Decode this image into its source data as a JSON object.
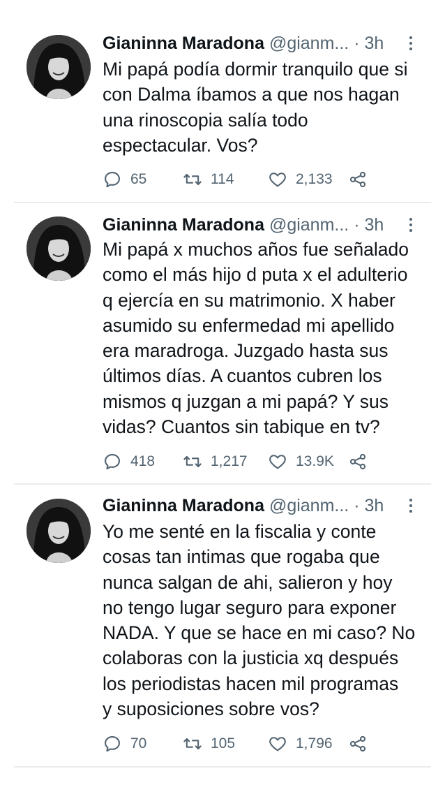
{
  "tweets": [
    {
      "author_name": "Gianinna Maradona",
      "handle": "@gianm...",
      "separator": "·",
      "time": "3h",
      "text": "Mi papá podía dormir tranquilo que si\ncon Dalma íbamos a que nos hagan\nuna rinoscopia salía todo\nespectacular. Vos?",
      "replies": "65",
      "retweets": "114",
      "likes": "2,133"
    },
    {
      "author_name": "Gianinna Maradona",
      "handle": "@gianm...",
      "separator": "·",
      "time": "3h",
      "text": "Mi papá x muchos años fue señalado\ncomo el más hijo d puta x el adulterio\nq ejercía en su matrimonio. X haber\nasumido su enfermedad mi apellido\nera maradroga. Juzgado hasta sus\núltimos días. A cuantos cubren los\nmismos q juzgan a mi papá? Y sus\nvidas? Cuantos sin tabique en tv?",
      "replies": "418",
      "retweets": "1,217",
      "likes": "13.9K"
    },
    {
      "author_name": "Gianinna Maradona",
      "handle": "@gianm...",
      "separator": "·",
      "time": "3h",
      "text": "Yo me senté en la fiscalia y conte\ncosas tan intimas que rogaba que\nnunca salgan de ahi, salieron y hoy\nno tengo lugar seguro para exponer\nNADA. Y que se hace en mi caso? No\ncolaboras con la justicia xq después\nlos periodistas hacen mil programas\ny suposiciones sobre vos?",
      "replies": "70",
      "retweets": "105",
      "likes": "1,796"
    }
  ],
  "icons": {
    "reply": "reply-icon",
    "retweet": "retweet-icon",
    "like": "heart-icon",
    "share": "share-icon",
    "more": "more-vertical-icon"
  },
  "colors": {
    "text": "#0f1419",
    "secondary": "#536471",
    "divider": "#e9ecef",
    "background": "#ffffff"
  }
}
